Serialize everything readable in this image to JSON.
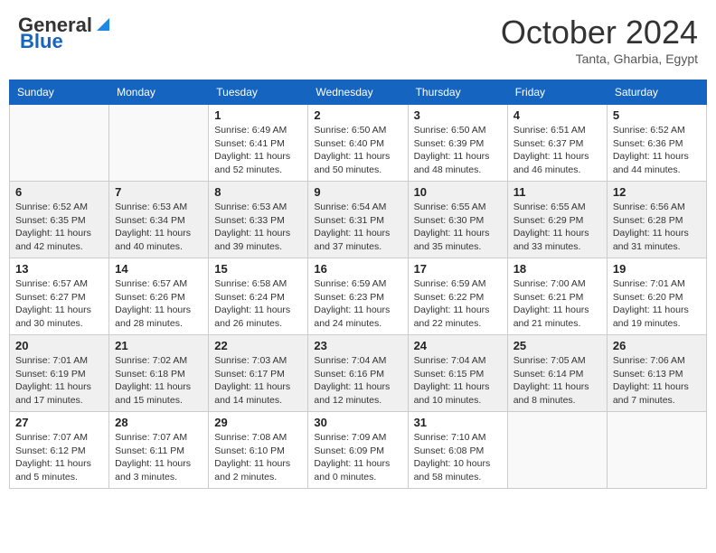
{
  "header": {
    "logo_general": "General",
    "logo_blue": "Blue",
    "month_title": "October 2024",
    "location": "Tanta, Gharbia, Egypt"
  },
  "days_of_week": [
    "Sunday",
    "Monday",
    "Tuesday",
    "Wednesday",
    "Thursday",
    "Friday",
    "Saturday"
  ],
  "weeks": [
    [
      {
        "day": "",
        "info": ""
      },
      {
        "day": "",
        "info": ""
      },
      {
        "day": "1",
        "info": "Sunrise: 6:49 AM\nSunset: 6:41 PM\nDaylight: 11 hours and 52 minutes."
      },
      {
        "day": "2",
        "info": "Sunrise: 6:50 AM\nSunset: 6:40 PM\nDaylight: 11 hours and 50 minutes."
      },
      {
        "day": "3",
        "info": "Sunrise: 6:50 AM\nSunset: 6:39 PM\nDaylight: 11 hours and 48 minutes."
      },
      {
        "day": "4",
        "info": "Sunrise: 6:51 AM\nSunset: 6:37 PM\nDaylight: 11 hours and 46 minutes."
      },
      {
        "day": "5",
        "info": "Sunrise: 6:52 AM\nSunset: 6:36 PM\nDaylight: 11 hours and 44 minutes."
      }
    ],
    [
      {
        "day": "6",
        "info": "Sunrise: 6:52 AM\nSunset: 6:35 PM\nDaylight: 11 hours and 42 minutes."
      },
      {
        "day": "7",
        "info": "Sunrise: 6:53 AM\nSunset: 6:34 PM\nDaylight: 11 hours and 40 minutes."
      },
      {
        "day": "8",
        "info": "Sunrise: 6:53 AM\nSunset: 6:33 PM\nDaylight: 11 hours and 39 minutes."
      },
      {
        "day": "9",
        "info": "Sunrise: 6:54 AM\nSunset: 6:31 PM\nDaylight: 11 hours and 37 minutes."
      },
      {
        "day": "10",
        "info": "Sunrise: 6:55 AM\nSunset: 6:30 PM\nDaylight: 11 hours and 35 minutes."
      },
      {
        "day": "11",
        "info": "Sunrise: 6:55 AM\nSunset: 6:29 PM\nDaylight: 11 hours and 33 minutes."
      },
      {
        "day": "12",
        "info": "Sunrise: 6:56 AM\nSunset: 6:28 PM\nDaylight: 11 hours and 31 minutes."
      }
    ],
    [
      {
        "day": "13",
        "info": "Sunrise: 6:57 AM\nSunset: 6:27 PM\nDaylight: 11 hours and 30 minutes."
      },
      {
        "day": "14",
        "info": "Sunrise: 6:57 AM\nSunset: 6:26 PM\nDaylight: 11 hours and 28 minutes."
      },
      {
        "day": "15",
        "info": "Sunrise: 6:58 AM\nSunset: 6:24 PM\nDaylight: 11 hours and 26 minutes."
      },
      {
        "day": "16",
        "info": "Sunrise: 6:59 AM\nSunset: 6:23 PM\nDaylight: 11 hours and 24 minutes."
      },
      {
        "day": "17",
        "info": "Sunrise: 6:59 AM\nSunset: 6:22 PM\nDaylight: 11 hours and 22 minutes."
      },
      {
        "day": "18",
        "info": "Sunrise: 7:00 AM\nSunset: 6:21 PM\nDaylight: 11 hours and 21 minutes."
      },
      {
        "day": "19",
        "info": "Sunrise: 7:01 AM\nSunset: 6:20 PM\nDaylight: 11 hours and 19 minutes."
      }
    ],
    [
      {
        "day": "20",
        "info": "Sunrise: 7:01 AM\nSunset: 6:19 PM\nDaylight: 11 hours and 17 minutes."
      },
      {
        "day": "21",
        "info": "Sunrise: 7:02 AM\nSunset: 6:18 PM\nDaylight: 11 hours and 15 minutes."
      },
      {
        "day": "22",
        "info": "Sunrise: 7:03 AM\nSunset: 6:17 PM\nDaylight: 11 hours and 14 minutes."
      },
      {
        "day": "23",
        "info": "Sunrise: 7:04 AM\nSunset: 6:16 PM\nDaylight: 11 hours and 12 minutes."
      },
      {
        "day": "24",
        "info": "Sunrise: 7:04 AM\nSunset: 6:15 PM\nDaylight: 11 hours and 10 minutes."
      },
      {
        "day": "25",
        "info": "Sunrise: 7:05 AM\nSunset: 6:14 PM\nDaylight: 11 hours and 8 minutes."
      },
      {
        "day": "26",
        "info": "Sunrise: 7:06 AM\nSunset: 6:13 PM\nDaylight: 11 hours and 7 minutes."
      }
    ],
    [
      {
        "day": "27",
        "info": "Sunrise: 7:07 AM\nSunset: 6:12 PM\nDaylight: 11 hours and 5 minutes."
      },
      {
        "day": "28",
        "info": "Sunrise: 7:07 AM\nSunset: 6:11 PM\nDaylight: 11 hours and 3 minutes."
      },
      {
        "day": "29",
        "info": "Sunrise: 7:08 AM\nSunset: 6:10 PM\nDaylight: 11 hours and 2 minutes."
      },
      {
        "day": "30",
        "info": "Sunrise: 7:09 AM\nSunset: 6:09 PM\nDaylight: 11 hours and 0 minutes."
      },
      {
        "day": "31",
        "info": "Sunrise: 7:10 AM\nSunset: 6:08 PM\nDaylight: 10 hours and 58 minutes."
      },
      {
        "day": "",
        "info": ""
      },
      {
        "day": "",
        "info": ""
      }
    ]
  ]
}
